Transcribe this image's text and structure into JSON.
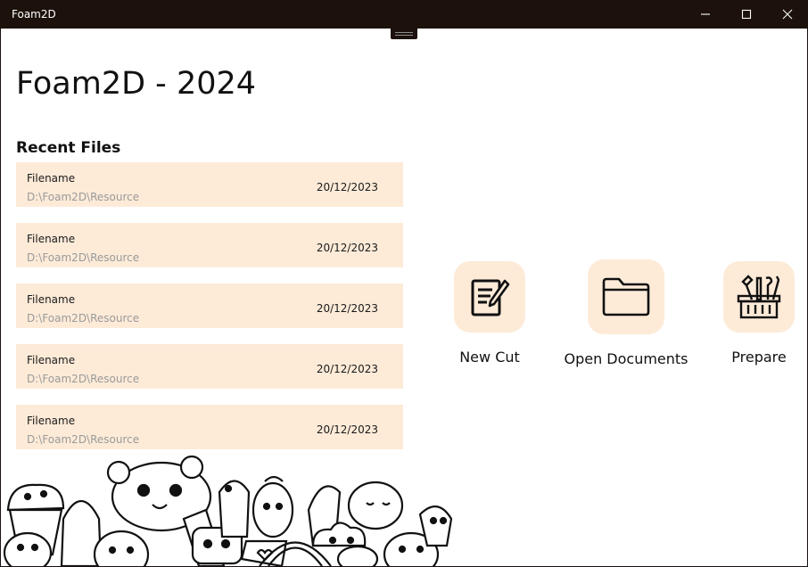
{
  "window": {
    "title": "Foam2D"
  },
  "main": {
    "title": "Foam2D - 2024",
    "recent_title": "Recent Files"
  },
  "recent_files": [
    {
      "name": "Filename",
      "path": "D:\\Foam2D\\Resource",
      "date": "20/12/2023"
    },
    {
      "name": "Filename",
      "path": "D:\\Foam2D\\Resource",
      "date": "20/12/2023"
    },
    {
      "name": "Filename",
      "path": "D:\\Foam2D\\Resource",
      "date": "20/12/2023"
    },
    {
      "name": "Filename",
      "path": "D:\\Foam2D\\Resource",
      "date": "20/12/2023"
    },
    {
      "name": "Filename",
      "path": "D:\\Foam2D\\Resource",
      "date": "20/12/2023"
    }
  ],
  "actions": [
    {
      "label": "New Cut",
      "icon": "document-pencil-icon"
    },
    {
      "label": "Open Documents",
      "icon": "folder-icon"
    },
    {
      "label": "Prepare",
      "icon": "toolbox-icon"
    }
  ],
  "colors": {
    "titlebar": "#1c120b",
    "accent_tile": "#fdebd8"
  }
}
